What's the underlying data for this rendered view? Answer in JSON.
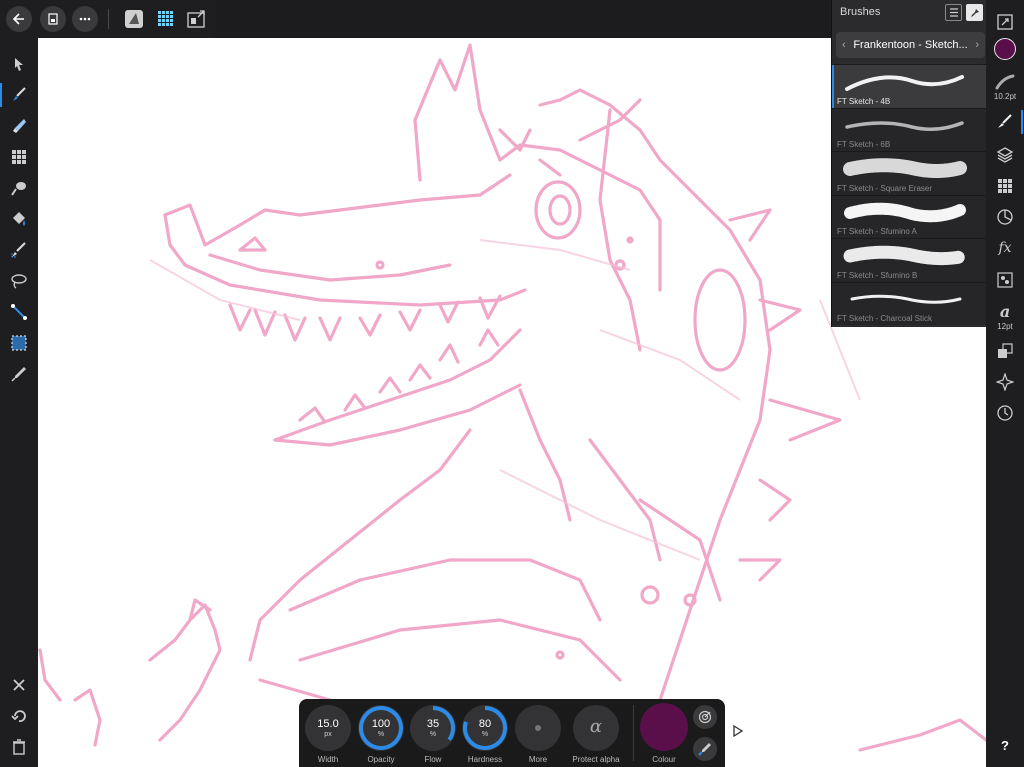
{
  "top_bar": {
    "back_icon": "back-arrow-icon",
    "document_icon": "document-icon",
    "more_icon": "more-dots-icon",
    "personas": [
      "designer-persona-icon",
      "pixel-persona-icon",
      "export-persona-icon"
    ]
  },
  "left_tools": [
    "move-tool-icon",
    "paint-brush-tool-icon",
    "erase-brush-tool-icon",
    "pixel-grid-tool-icon",
    "smudge-tool-icon",
    "flood-fill-tool-icon",
    "selection-brush-tool-icon",
    "freehand-selection-tool-icon",
    "gradient-tool-icon",
    "marquee-tool-icon",
    "color-picker-tool-icon"
  ],
  "left_bottom": [
    "close-icon",
    "undo-icon",
    "delete-icon"
  ],
  "right_toolbar": {
    "colour_swatch": "#5a0f4a",
    "brush_size_label": "10.2pt",
    "text_size_label": "12pt"
  },
  "brushes_panel": {
    "title": "Brushes",
    "category": "Frankentoon - Sketch...",
    "brushes": [
      {
        "name": "FT Sketch - 4B",
        "selected": true
      },
      {
        "name": "FT Sketch - 6B",
        "selected": false
      },
      {
        "name": "FT Sketch - Square Eraser",
        "selected": false
      },
      {
        "name": "FT Sketch - Sfumino A",
        "selected": false
      },
      {
        "name": "FT Sketch - Sfumino B",
        "selected": false
      },
      {
        "name": "FT Sketch - Charcoal Stick",
        "selected": false
      }
    ]
  },
  "context_toolbar": {
    "width": {
      "value": "15.0",
      "unit": "px",
      "label": "Width"
    },
    "opacity": {
      "value": "100",
      "unit": "%",
      "label": "Opacity",
      "fraction": 1.0
    },
    "flow": {
      "value": "35",
      "unit": "%",
      "label": "Flow",
      "fraction": 0.35
    },
    "hardness": {
      "value": "80",
      "unit": "%",
      "label": "Hardness",
      "fraction": 0.8
    },
    "more_label": "More",
    "protect_alpha_symbol": "α",
    "protect_alpha_label": "Protect alpha",
    "colour_label": "Colour",
    "colour": "#5a0f4a",
    "accent": "#2d8be6"
  },
  "help_label": "?"
}
